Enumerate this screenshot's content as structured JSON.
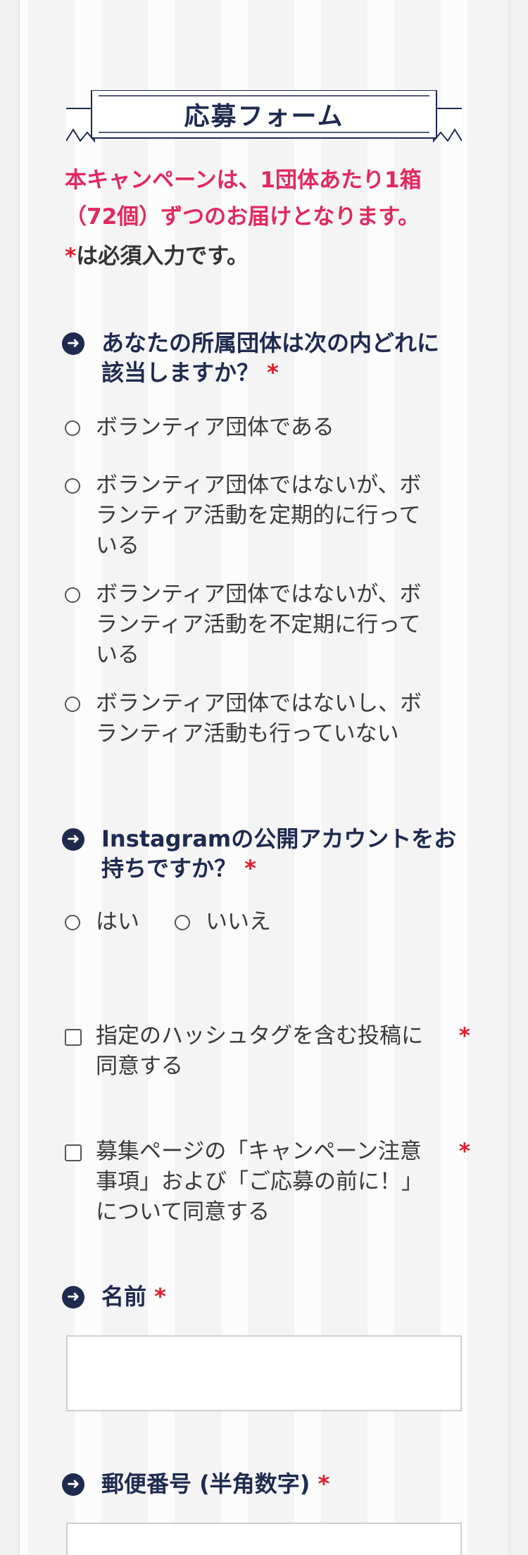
{
  "form": {
    "title": "応募フォーム",
    "notice_line1": "本キャンペーンは、1団体あたり1箱",
    "notice_line2": "（72個）ずつのお届けとなります。",
    "required_mark": "*",
    "required_note": "は必須入力です。"
  },
  "q_org": {
    "heading_line1": "あなたの所属団体は次の内どれに",
    "heading_line2": "該当しますか？",
    "options": [
      {
        "line1": "ボランティア団体である",
        "line2": "",
        "line3": ""
      },
      {
        "line1": "ボランティア団体ではないが、ボ",
        "line2": "ランティア活動を定期的に行って",
        "line3": "いる"
      },
      {
        "line1": "ボランティア団体ではないが、ボ",
        "line2": "ランティア活動を不定期に行って",
        "line3": "いる"
      },
      {
        "line1": "ボランティア団体ではないし、ボ",
        "line2": "ランティア活動も行っていない",
        "line3": ""
      }
    ]
  },
  "q_instagram": {
    "heading_line1": "Instagramの公開アカウントをお",
    "heading_line2": "持ちですか？",
    "options": [
      "はい",
      "いいえ"
    ]
  },
  "agree_hashtag": {
    "line1": "指定のハッシュタグを含む投稿に",
    "line2": "同意する"
  },
  "agree_terms": {
    "line1": "募集ページの「キャンペーン注意",
    "line2": "事項」および「ご応募の前に！」",
    "line3": "について同意する"
  },
  "field_name": {
    "label": "名前"
  },
  "field_postal": {
    "label": "郵便番号 (半角数字)"
  },
  "colors": {
    "navy": "#1f2a4f",
    "pink": "#e2285f",
    "required_red": "#e21b2a"
  }
}
